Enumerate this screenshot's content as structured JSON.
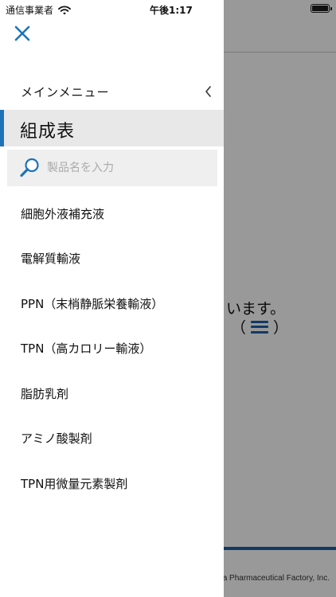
{
  "status_bar": {
    "carrier": "通信事業者",
    "time": "午後1:17"
  },
  "background": {
    "message_line1": "います。",
    "message_line2_open": "（",
    "message_line2_close": "）",
    "footer": "a Pharmaceutical Factory, Inc.",
    "accent_color": "#1f5fa8"
  },
  "drawer": {
    "menu_header": "メインメニュー",
    "section_title": "組成表",
    "accent_color": "#1e73b8",
    "search": {
      "placeholder": "製品名を入力",
      "value": ""
    },
    "items": [
      {
        "label": "細胞外液補充液"
      },
      {
        "label": "電解質輸液"
      },
      {
        "label": "PPN（末梢静脈栄養輸液）"
      },
      {
        "label": "TPN（高カロリー輸液）"
      },
      {
        "label": "脂肪乳剤"
      },
      {
        "label": "アミノ酸製剤"
      },
      {
        "label": "TPN用微量元素製剤"
      }
    ]
  }
}
